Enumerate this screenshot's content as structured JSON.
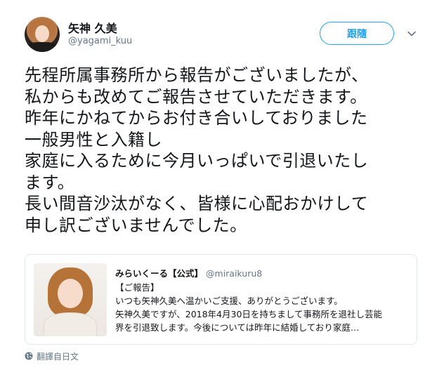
{
  "author": {
    "display_name": "矢神 久美",
    "handle": "@yagami_kuu"
  },
  "follow_button_label": "跟隨",
  "icons": {
    "avatar": "avatar",
    "more": "chevron-down-icon",
    "translate": "globe-icon"
  },
  "tweet_lines": [
    "先程所属事務所から報告がございましたが、",
    "私からも改めてご報告させていただきます。",
    "昨年にかねてからお付き合いしておりました",
    "一般男性と入籍し",
    "家庭に入るために今月いっぱいで引退いたし",
    "ます。",
    "長い間音沙汰がなく、皆様に心配おかけして",
    "申し訳ございませんでした。"
  ],
  "quote": {
    "name": "みらいくーる【公式】",
    "handle": "@miraikuru8",
    "lines": [
      "【ご報告】",
      "いつも矢神久美へ温かいご支援、ありがとうございます。",
      "矢神久美ですが、2018年4月30日を持ちまして事務所を退社し芸能",
      "界を引退致します。今後については昨年に結婚しており家庭…"
    ]
  },
  "translate_label": "翻譯自日文",
  "colors": {
    "accent": "#1da1f2",
    "secondary_text": "#657786",
    "border": "#e1e8ed"
  }
}
